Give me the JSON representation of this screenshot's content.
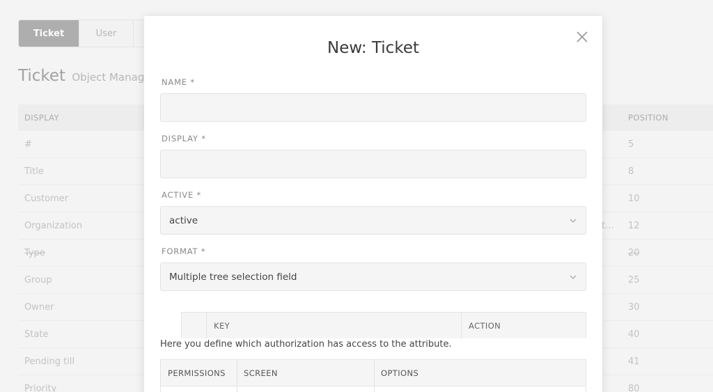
{
  "tabs": [
    {
      "label": "Ticket",
      "active": true
    },
    {
      "label": "User",
      "active": false
    }
  ],
  "page": {
    "title": "Ticket",
    "subtitle": "Object Manager"
  },
  "bg_table": {
    "headers": {
      "display": "DISPLAY",
      "position": "POSITION"
    },
    "rows": [
      {
        "name": "#",
        "position": "5",
        "strike": false
      },
      {
        "name": "Title",
        "position": "8",
        "strike": false
      },
      {
        "name": "Customer",
        "position": "10",
        "strike": false
      },
      {
        "name": "Organization",
        "position": "12",
        "strike": false,
        "extra": "t..."
      },
      {
        "name": "Type",
        "position": "20",
        "strike": true
      },
      {
        "name": "Group",
        "position": "25",
        "strike": false
      },
      {
        "name": "Owner",
        "position": "30",
        "strike": false
      },
      {
        "name": "State",
        "position": "40",
        "strike": false
      },
      {
        "name": "Pending till",
        "position": "41",
        "strike": false
      },
      {
        "name": "Priority",
        "position": "80",
        "strike": false
      }
    ]
  },
  "modal": {
    "title": "New: Ticket",
    "name_label": "NAME *",
    "name_value": "",
    "display_label": "DISPLAY *",
    "display_value": "",
    "active_label": "ACTIVE *",
    "active_value": "active",
    "format_label": "FORMAT *",
    "format_value": "Multiple tree selection field",
    "kv_table": {
      "key": "KEY",
      "action": "ACTION"
    },
    "permission_info": "Here you define which authorization has access to the attribute.",
    "perm_table": {
      "permissions": "PERMISSIONS",
      "screen": "SCREEN",
      "options": "OPTIONS"
    }
  },
  "icons": {
    "close": "close-icon",
    "chevron": "chevron-down-icon"
  }
}
